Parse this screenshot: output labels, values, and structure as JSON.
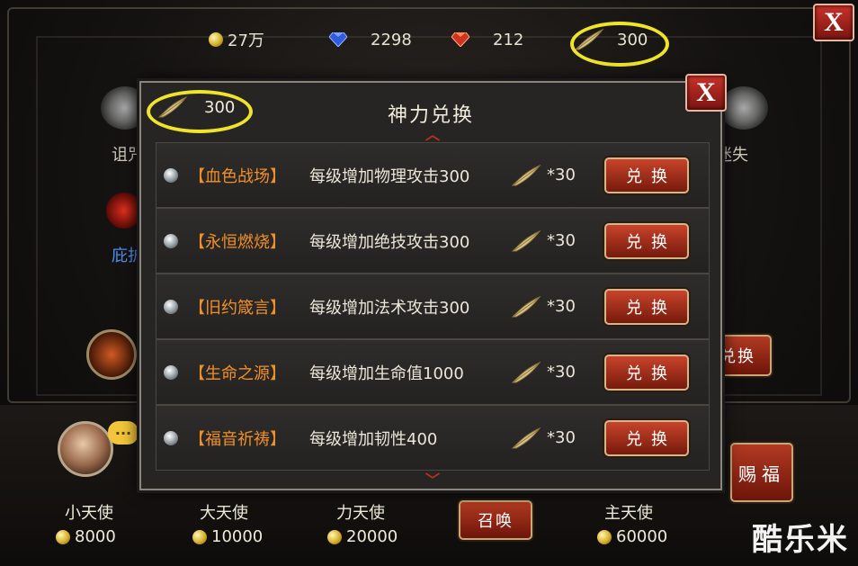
{
  "top_bar": {
    "gold": "27万",
    "diamonds": "2298",
    "rubies": "212",
    "divine_feathers": "300",
    "colors": {
      "highlight_ring": "#f0e42a",
      "accent_red": "#b23a22"
    }
  },
  "background": {
    "left_label": "诅咒",
    "right_label": "迷失",
    "side_label": "庇护",
    "side_button": "兑换"
  },
  "modal": {
    "title": "神力兑换",
    "counter": "300",
    "items": [
      {
        "name": "【血色战场】",
        "desc": "每级增加物理攻击300",
        "cost": "*30",
        "button": "兑换"
      },
      {
        "name": "【永恒燃烧】",
        "desc": "每级增加绝技攻击300",
        "cost": "*30",
        "button": "兑换"
      },
      {
        "name": "【旧约箴言】",
        "desc": "每级增加法术攻击300",
        "cost": "*30",
        "button": "兑换"
      },
      {
        "name": "【生命之源】",
        "desc": "每级增加生命值1000",
        "cost": "*30",
        "button": "兑换"
      },
      {
        "name": "【福音祈祷】",
        "desc": "每级增加韧性400",
        "cost": "*30",
        "button": "兑换"
      }
    ]
  },
  "bottom": {
    "angels": [
      {
        "name": "小天使",
        "cost": "8000"
      },
      {
        "name": "大天使",
        "cost": "10000"
      },
      {
        "name": "力天使",
        "cost": "20000"
      },
      {
        "name": "主天使",
        "cost": "60000"
      }
    ],
    "summon_button": "召唤",
    "bless_button": "赐福",
    "chat_icon": "···"
  },
  "watermark": "酷乐米"
}
